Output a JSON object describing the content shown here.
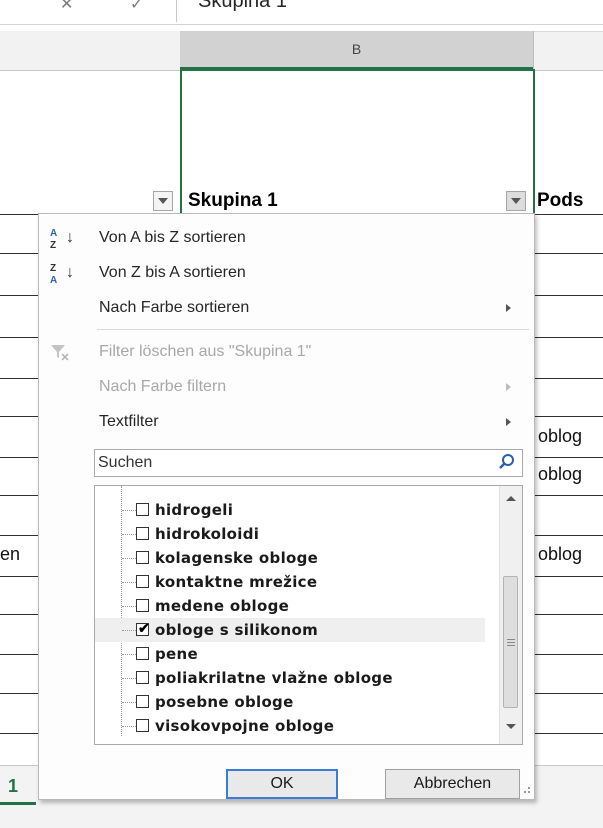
{
  "formula_bar": {
    "value": "Skupina 1"
  },
  "column_header": {
    "col_b": "B"
  },
  "headers": {
    "col_b": "Skupina 1",
    "col_c": "Pods"
  },
  "grid_cells": {
    "c_rows": [
      "oblog",
      "oblog",
      "oblog"
    ],
    "a_rows": [
      "en"
    ]
  },
  "sheet_tab": {
    "label": "1"
  },
  "filter_menu": {
    "items": [
      {
        "label": "Von A bis Z sortieren",
        "icon": "sort-a-z-icon",
        "enabled": true,
        "submenu": false
      },
      {
        "label": "Von Z bis A sortieren",
        "icon": "sort-z-a-icon",
        "enabled": true,
        "submenu": false
      },
      {
        "label": "Nach Farbe sortieren",
        "icon": "",
        "enabled": true,
        "submenu": true
      },
      {
        "label": "Filter löschen aus \"Skupina 1\"",
        "icon": "clear-filter-icon",
        "enabled": false,
        "submenu": false
      },
      {
        "label": "Nach Farbe filtern",
        "icon": "",
        "enabled": false,
        "submenu": true
      },
      {
        "label": "Textfilter",
        "icon": "",
        "enabled": true,
        "submenu": true
      }
    ],
    "search": {
      "placeholder": "Suchen"
    },
    "list": [
      {
        "label": "hidrogeli",
        "checked": false
      },
      {
        "label": "hidrokoloidi",
        "checked": false
      },
      {
        "label": "kolagenske obloge",
        "checked": false
      },
      {
        "label": "kontaktne mrežice",
        "checked": false
      },
      {
        "label": "medene obloge",
        "checked": false
      },
      {
        "label": "obloge s silikonom",
        "checked": true
      },
      {
        "label": "pene",
        "checked": false
      },
      {
        "label": "poliakrilatne vlažne obloge",
        "checked": false
      },
      {
        "label": "posebne obloge",
        "checked": false
      },
      {
        "label": "visokovpojne obloge",
        "checked": false
      }
    ],
    "buttons": {
      "ok": "OK",
      "cancel": "Abbrechen"
    }
  },
  "colors": {
    "accent": "#217346",
    "ok_border": "#3d7bd9"
  }
}
